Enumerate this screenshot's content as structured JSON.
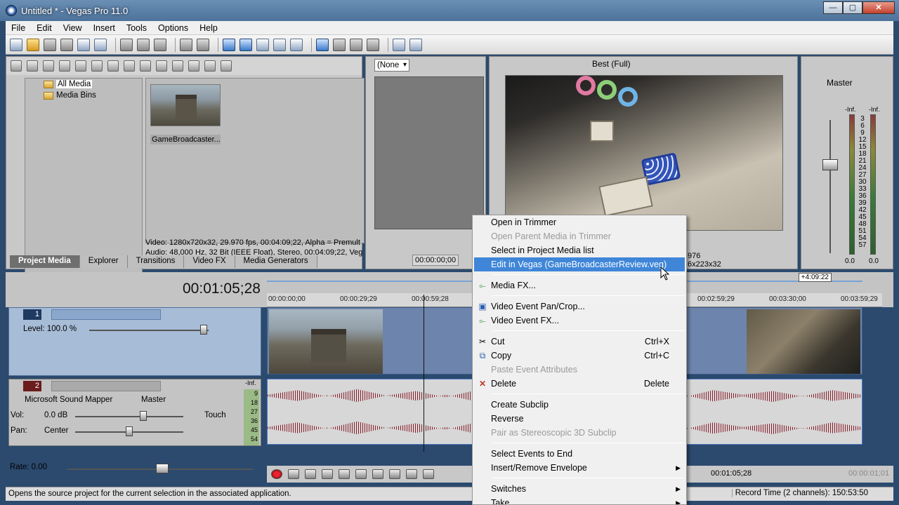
{
  "window": {
    "title": "Untitled * - Vegas Pro 11.0",
    "buttons": [
      "—",
      "▢",
      "✕"
    ]
  },
  "menu": [
    "File",
    "Edit",
    "View",
    "Insert",
    "Tools",
    "Options",
    "Help"
  ],
  "project_media": {
    "tree": [
      "All Media",
      "Media Bins"
    ],
    "thumb_label": "GameBroadcaster...",
    "info_line1": "Video: 1280x720x32, 29.970 fps, 00:04:09;22, Alpha = Premult",
    "info_line2": "Audio: 48,000 Hz, 32 Bit (IEEE Float), Stereo, 00:04:09;22, Veg",
    "tabs": [
      "Project Media",
      "Explorer",
      "Transitions",
      "Video FX",
      "Media Generators"
    ]
  },
  "trimmer": {
    "select": "(None",
    "timecode": "00:00:00;00"
  },
  "preview": {
    "quality": "Best (Full)",
    "frame_partial": "976",
    "size_partial": "6x223x32"
  },
  "mixer": {
    "label": "Master",
    "inf_left": "-Inf.",
    "inf_right": "-Inf.",
    "scale": [
      "3",
      "6",
      "9",
      "12",
      "15",
      "18",
      "21",
      "24",
      "27",
      "30",
      "33",
      "36",
      "39",
      "42",
      "45",
      "48",
      "51",
      "54",
      "57"
    ],
    "val_left": "0.0",
    "val_right": "0.0"
  },
  "timeline": {
    "timecode": "00:01:05;28",
    "end_marker": "+4:09:22",
    "ruler": [
      "00:00:00;00",
      "00:00:29;29",
      "00:00:59;28",
      "00:02:59;29",
      "00:03:30;00",
      "00:03:59;29"
    ],
    "video_track": {
      "number": "1",
      "level_label": "Level: 100.0 %"
    },
    "audio_track": {
      "number": "2",
      "device": "Microsoft Sound Mapper",
      "bus": "Master",
      "vol_label": "Vol:",
      "vol_value": "0.0 dB",
      "pan_label": "Pan:",
      "pan_value": "Center",
      "automation": "Touch",
      "inf": "-Inf.",
      "meter_scale": [
        "9",
        "18",
        "27",
        "36",
        "45",
        "54"
      ]
    },
    "rate": "Rate: 0.00"
  },
  "transport": {
    "timecode": "00:01:05;28",
    "end_tc": "00:00:01;01"
  },
  "status": {
    "text": "Opens the source project for the current selection in the associated application.",
    "record_time": "Record Time (2 channels): 150:53:50"
  },
  "context_menu": {
    "items": [
      {
        "label": "Open in Trimmer",
        "state": "normal"
      },
      {
        "label": "Open Parent Media in Trimmer",
        "state": "disabled"
      },
      {
        "label": "Select in Project Media list",
        "state": "normal"
      },
      {
        "label": "Edit in Vegas (GameBroadcasterReview.veg)",
        "state": "highlight"
      },
      {
        "label": "Media FX...",
        "state": "normal",
        "icon": "fx-icon"
      },
      {
        "label": "Video Event Pan/Crop...",
        "state": "normal",
        "icon": "pan-crop-icon"
      },
      {
        "label": "Video Event FX...",
        "state": "normal",
        "icon": "fx-icon"
      },
      {
        "label": "Cut",
        "state": "normal",
        "shortcut": "Ctrl+X",
        "icon": "scissors-icon"
      },
      {
        "label": "Copy",
        "state": "normal",
        "shortcut": "Ctrl+C",
        "icon": "copy-icon"
      },
      {
        "label": "Paste Event Attributes",
        "state": "disabled"
      },
      {
        "label": "Delete",
        "state": "normal",
        "shortcut": "Delete",
        "icon": "delete-icon"
      },
      {
        "label": "Create Subclip",
        "state": "normal"
      },
      {
        "label": "Reverse",
        "state": "normal"
      },
      {
        "label": "Pair as Stereoscopic 3D Subclip",
        "state": "disabled"
      },
      {
        "label": "Select Events to End",
        "state": "normal"
      },
      {
        "label": "Insert/Remove Envelope",
        "state": "normal",
        "submenu": true
      },
      {
        "label": "Switches",
        "state": "normal",
        "submenu": true
      },
      {
        "label": "Take",
        "state": "normal",
        "submenu": true
      }
    ]
  }
}
